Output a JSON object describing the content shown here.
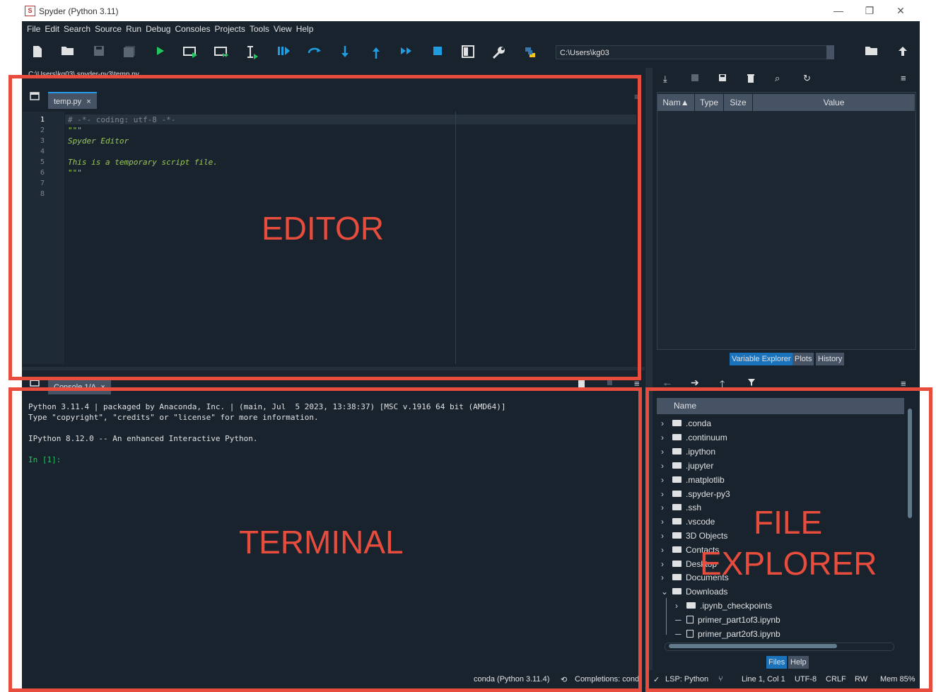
{
  "window": {
    "title": "Spyder (Python 3.11)",
    "logo": "S"
  },
  "menubar": [
    "File",
    "Edit",
    "Search",
    "Source",
    "Run",
    "Debug",
    "Consoles",
    "Projects",
    "Tools",
    "View",
    "Help"
  ],
  "toolbar": {
    "path": "C:\\Users\\kg03",
    "icons": [
      "new-file",
      "open-file",
      "save",
      "save-all",
      "run",
      "run-cell",
      "run-cell-advance",
      "run-selection",
      "debug",
      "step",
      "step-into",
      "step-return",
      "continue",
      "stop",
      "maximize-pane",
      "preferences",
      "python-path-manager"
    ]
  },
  "editor": {
    "filepath_bar": "C:\\Users\\kg03\\.spyder-py3\\temp.py",
    "tab_label": "temp.py",
    "tab_close": "×",
    "line_numbers": [
      "1",
      "2",
      "3",
      "4",
      "5",
      "6",
      "7",
      "8"
    ],
    "code_lines": [
      "# -*- coding: utf-8 -*-",
      "\"\"\"",
      "Spyder Editor",
      "",
      "This is a temporary script file.",
      "\"\"\"",
      "",
      ""
    ],
    "colors": {
      "comment": "#7d8590",
      "docstring": "#9ac85a",
      "docstring_italic": "#9ac85a"
    }
  },
  "annotations": {
    "editor": "EDITOR",
    "terminal": "TERMINAL",
    "file_explorer_1": "FILE",
    "file_explorer_2": "EXPLORER",
    "color": "#e74c3c"
  },
  "console": {
    "tab_label": "Console 1/A",
    "tab_close": "×",
    "lines": [
      "Python 3.11.4 | packaged by Anaconda, Inc. | (main, Jul  5 2023, 13:38:37) [MSC v.1916 64 bit (AMD64)]",
      "Type \"copyright\", \"credits\" or \"license\" for more information.",
      "",
      "IPython 8.12.0 -- An enhanced Interactive Python.",
      "",
      "In [1]:"
    ],
    "prompt_color": "#22c55e"
  },
  "variable_explorer": {
    "headers": [
      "Nam▲",
      "Type",
      "Size",
      "Value"
    ],
    "tabs": [
      "Variable Explorer",
      "Plots",
      "History"
    ],
    "active_tab": "Variable Explorer"
  },
  "file_explorer": {
    "header": "Name",
    "items": [
      {
        "label": ".conda",
        "kind": "folder",
        "expanded": false,
        "indent": 0
      },
      {
        "label": ".continuum",
        "kind": "folder",
        "expanded": false,
        "indent": 0
      },
      {
        "label": ".ipython",
        "kind": "folder",
        "expanded": false,
        "indent": 0
      },
      {
        "label": ".jupyter",
        "kind": "folder",
        "expanded": false,
        "indent": 0
      },
      {
        "label": ".matplotlib",
        "kind": "folder",
        "expanded": false,
        "indent": 0
      },
      {
        "label": ".spyder-py3",
        "kind": "folder",
        "expanded": false,
        "indent": 0
      },
      {
        "label": ".ssh",
        "kind": "folder",
        "expanded": false,
        "indent": 0
      },
      {
        "label": ".vscode",
        "kind": "folder",
        "expanded": false,
        "indent": 0
      },
      {
        "label": "3D Objects",
        "kind": "folder",
        "expanded": false,
        "indent": 0
      },
      {
        "label": "Contacts",
        "kind": "folder",
        "expanded": false,
        "indent": 0
      },
      {
        "label": "Desktop",
        "kind": "folder",
        "expanded": false,
        "indent": 0
      },
      {
        "label": "Documents",
        "kind": "folder",
        "expanded": false,
        "indent": 0
      },
      {
        "label": "Downloads",
        "kind": "folder",
        "expanded": true,
        "indent": 0
      },
      {
        "label": ".ipynb_checkpoints",
        "kind": "folder",
        "expanded": false,
        "indent": 1
      },
      {
        "label": "primer_part1of3.ipynb",
        "kind": "file",
        "expanded": false,
        "indent": 1
      },
      {
        "label": "primer_part2of3.ipynb",
        "kind": "file",
        "expanded": false,
        "indent": 1
      }
    ],
    "tabs": [
      "Files",
      "Help"
    ],
    "active_tab": "Files"
  },
  "statusbar": {
    "env": "conda (Python 3.11.4)",
    "completions": "Completions: cond",
    "lsp": "LSP: Python",
    "position": "Line 1, Col 1",
    "encoding": "UTF-8",
    "eol": "CRLF",
    "mode": "RW",
    "mem": "Mem 85%"
  }
}
